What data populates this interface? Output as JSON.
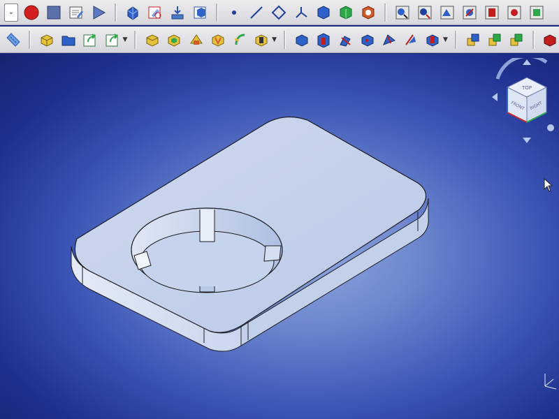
{
  "toolbar_top": {
    "items": [
      "macro-dropdown",
      "record-macro",
      "stop-macro",
      "macro-editor",
      "execute-macro",
      "part-design-workbench",
      "sketch",
      "import",
      "part-box",
      "point",
      "line",
      "diamond",
      "axis-tree",
      "iso-view",
      "front-view",
      "right-view",
      "measure-1",
      "measure-2",
      "measure-3",
      "measure-4",
      "measure-5",
      "measure-6",
      "measure-7"
    ]
  },
  "toolbar_bottom": {
    "items": [
      "ruler",
      "attach-sketch",
      "open-folder",
      "export-1",
      "export-2",
      "pad",
      "pocket",
      "revolution",
      "groove",
      "loft",
      "pipe",
      "fillet",
      "chamfer",
      "draft",
      "thickness",
      "mirror",
      "linear-pattern",
      "polar-pattern",
      "multi-transform",
      "boolean-a",
      "boolean-b",
      "boolean-c",
      "box-red"
    ]
  },
  "viewport": {
    "model": "plate-with-circular-cutout",
    "colors": {
      "bg_center": "#8da7dc",
      "bg_edge": "#182370",
      "part_face": "#c7d4ec",
      "part_side": "#d8e2f2",
      "part_edge": "#1c1c24"
    }
  },
  "navcube": {
    "face_top": "TOP",
    "face_front": "FRONT",
    "face_right": "RIGHT"
  }
}
